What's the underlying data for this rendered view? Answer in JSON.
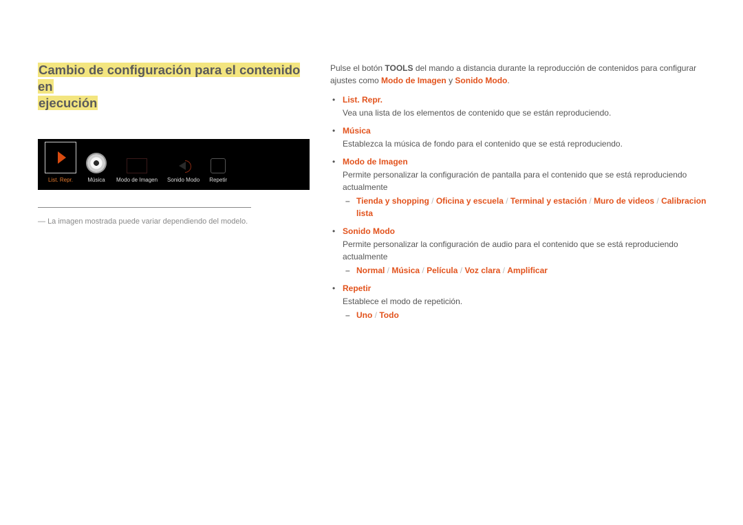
{
  "title_line1": "Cambio de configuración para el contenido en",
  "title_line2": "ejecución",
  "player": {
    "list_repr": "List. Repr.",
    "musica": "Música",
    "modo_imagen": "Modo de Imagen",
    "sonido_modo": "Sonido Modo",
    "repetir": "Repetir"
  },
  "footnote": "La imagen mostrada puede variar dependiendo del modelo.",
  "intro": {
    "p1a": "Pulse el botón ",
    "tools": "TOOLS",
    "p1b": " del mando a distancia durante la reproducción de contenidos para configurar ajustes como ",
    "modo_de": "Modo de",
    "imagen": "Imagen",
    "y": " y ",
    "sonido_modo": "Sonido Modo",
    "dot": "."
  },
  "items": {
    "list_repr": {
      "label": "List. Repr.",
      "desc": "Vea una lista de los elementos de contenido que se están reproduciendo."
    },
    "musica": {
      "label": "Música",
      "desc": "Establezca la música de fondo para el contenido que se está reproduciendo."
    },
    "modo_imagen": {
      "label": "Modo de Imagen",
      "desc": "Permite personalizar la configuración de pantalla para el contenido que se está reproduciendo actualmente",
      "opts": [
        "Tienda y shopping",
        "Oficina y escuela",
        "Terminal y estación",
        "Muro de videos",
        "Calibracion lista"
      ]
    },
    "sonido_modo": {
      "label": "Sonido Modo",
      "desc": "Permite personalizar la configuración de audio para el contenido que se está reproduciendo actualmente",
      "opts": [
        "Normal",
        "Música",
        "Película",
        "Voz clara",
        "Amplificar"
      ]
    },
    "repetir": {
      "label": "Repetir",
      "desc": "Establece el modo de repetición.",
      "opts": [
        "Uno",
        "Todo"
      ]
    }
  },
  "sep": " / "
}
